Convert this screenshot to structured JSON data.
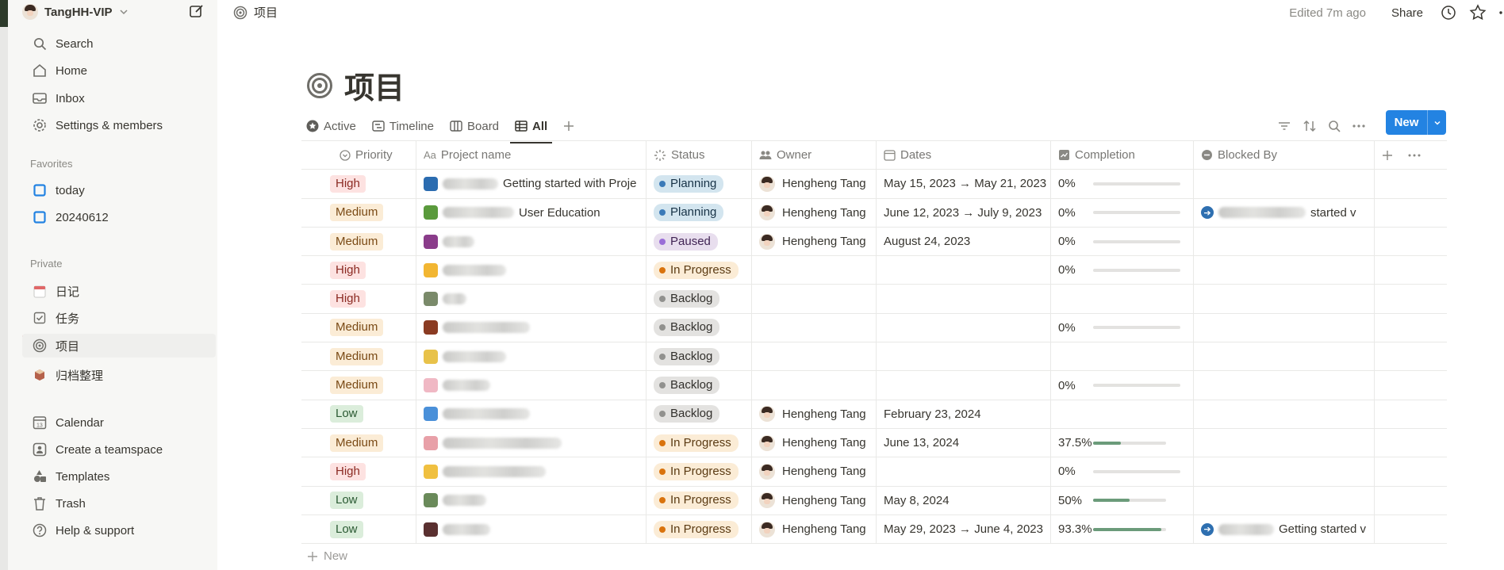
{
  "workspace": {
    "name": "TangHH-VIP"
  },
  "sidebar": {
    "top": [
      {
        "label": "Search",
        "icon": "search-icon"
      },
      {
        "label": "Home",
        "icon": "home-icon"
      },
      {
        "label": "Inbox",
        "icon": "inbox-icon"
      },
      {
        "label": "Settings & members",
        "icon": "gear-icon"
      }
    ],
    "favorites_label": "Favorites",
    "favorites": [
      {
        "label": "today"
      },
      {
        "label": "20240612"
      }
    ],
    "private_label": "Private",
    "private": [
      {
        "label": "日记",
        "icon": "calendar-page-icon"
      },
      {
        "label": "任务",
        "icon": "checkbox-icon"
      },
      {
        "label": "项目",
        "icon": "target-icon"
      },
      {
        "label": "归档整理",
        "icon": "archive-box-icon"
      }
    ],
    "bottom": [
      {
        "label": "Calendar",
        "icon": "calendar-icon"
      },
      {
        "label": "Create a teamspace",
        "icon": "teamspace-icon"
      },
      {
        "label": "Templates",
        "icon": "templates-icon"
      },
      {
        "label": "Trash",
        "icon": "trash-icon"
      },
      {
        "label": "Help & support",
        "icon": "help-icon"
      }
    ]
  },
  "topbar": {
    "breadcrumb": "项目",
    "edited": "Edited 7m ago",
    "share": "Share"
  },
  "page": {
    "title": "项目"
  },
  "views": [
    {
      "label": "Active"
    },
    {
      "label": "Timeline"
    },
    {
      "label": "Board"
    },
    {
      "label": "All"
    }
  ],
  "new_button": "New",
  "columns": {
    "priority": "Priority",
    "name": "Project name",
    "status": "Status",
    "owner": "Owner",
    "dates": "Dates",
    "completion": "Completion",
    "blocked": "Blocked By"
  },
  "rows": [
    {
      "priority": "High",
      "emoji": "#2b6cb0",
      "name": "Getting started with Proje",
      "status": "Planning",
      "owner": "Hengheng Tang",
      "dates": "May 15, 2023 → May 21, 2023",
      "pct": "0%",
      "fill": 0,
      "blocked": ""
    },
    {
      "priority": "Medium",
      "emoji": "#5a9a3c",
      "name": "User Education",
      "status": "Planning",
      "owner": "Hengheng Tang",
      "dates": "June 12, 2023 → July 9, 2023",
      "pct": "0%",
      "fill": 0,
      "blocked": "started v"
    },
    {
      "priority": "Medium",
      "emoji": "#8a3c8a",
      "name": "",
      "status": "Paused",
      "owner": "Hengheng Tang",
      "dates": "August 24, 2023",
      "pct": "0%",
      "fill": 0,
      "blocked": ""
    },
    {
      "priority": "High",
      "emoji": "#f2b632",
      "name": "",
      "status": "In Progress",
      "owner": "",
      "dates": "",
      "pct": "0%",
      "fill": 0,
      "blocked": ""
    },
    {
      "priority": "High",
      "emoji": "#7a8a6a",
      "name": "",
      "status": "Backlog",
      "owner": "",
      "dates": "",
      "pct": "",
      "fill": null,
      "blocked": ""
    },
    {
      "priority": "Medium",
      "emoji": "#8a3b22",
      "name": "",
      "status": "Backlog",
      "owner": "",
      "dates": "",
      "pct": "0%",
      "fill": 0,
      "blocked": ""
    },
    {
      "priority": "Medium",
      "emoji": "#e8c24a",
      "name": "",
      "status": "Backlog",
      "owner": "",
      "dates": "",
      "pct": "",
      "fill": null,
      "blocked": ""
    },
    {
      "priority": "Medium",
      "emoji": "#f0b8c4",
      "name": "",
      "status": "Backlog",
      "owner": "",
      "dates": "",
      "pct": "0%",
      "fill": 0,
      "blocked": ""
    },
    {
      "priority": "Low",
      "emoji": "#4a90d9",
      "name": "",
      "status": "Backlog",
      "owner": "Hengheng Tang",
      "dates": "February 23, 2024",
      "pct": "",
      "fill": null,
      "blocked": ""
    },
    {
      "priority": "Medium",
      "emoji": "#e8a0a8",
      "name": "",
      "status": "In Progress",
      "owner": "Hengheng Tang",
      "dates": "June 13, 2024",
      "pct": "37.5%",
      "fill": 0.375,
      "blocked": ""
    },
    {
      "priority": "High",
      "emoji": "#f0c040",
      "name": "",
      "status": "In Progress",
      "owner": "Hengheng Tang",
      "dates": "",
      "pct": "0%",
      "fill": 0,
      "blocked": ""
    },
    {
      "priority": "Low",
      "emoji": "#6a8a5a",
      "name": "",
      "status": "In Progress",
      "owner": "Hengheng Tang",
      "dates": "May 8, 2024",
      "pct": "50%",
      "fill": 0.5,
      "blocked": ""
    },
    {
      "priority": "Low",
      "emoji": "#5a3030",
      "name": "",
      "status": "In Progress",
      "owner": "Hengheng Tang",
      "dates": "May 29, 2023 → June 4, 2023",
      "pct": "93.3%",
      "fill": 0.933,
      "blocked": "Getting started v"
    }
  ],
  "new_row": "New"
}
